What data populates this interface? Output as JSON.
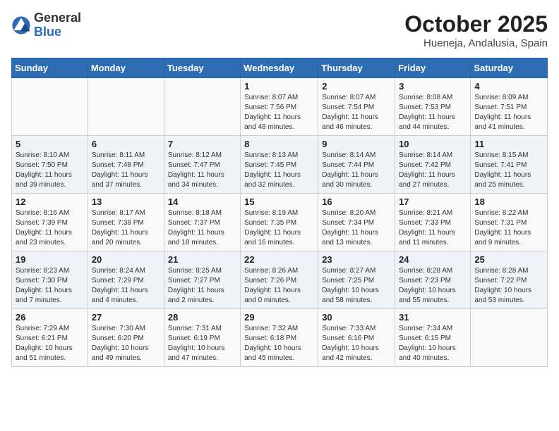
{
  "header": {
    "logo_general": "General",
    "logo_blue": "Blue",
    "month_title": "October 2025",
    "location": "Hueneja, Andalusia, Spain"
  },
  "weekdays": [
    "Sunday",
    "Monday",
    "Tuesday",
    "Wednesday",
    "Thursday",
    "Friday",
    "Saturday"
  ],
  "weeks": [
    [
      {
        "day": "",
        "info": ""
      },
      {
        "day": "",
        "info": ""
      },
      {
        "day": "",
        "info": ""
      },
      {
        "day": "1",
        "info": "Sunrise: 8:07 AM\nSunset: 7:56 PM\nDaylight: 11 hours and 48 minutes."
      },
      {
        "day": "2",
        "info": "Sunrise: 8:07 AM\nSunset: 7:54 PM\nDaylight: 11 hours and 46 minutes."
      },
      {
        "day": "3",
        "info": "Sunrise: 8:08 AM\nSunset: 7:53 PM\nDaylight: 11 hours and 44 minutes."
      },
      {
        "day": "4",
        "info": "Sunrise: 8:09 AM\nSunset: 7:51 PM\nDaylight: 11 hours and 41 minutes."
      }
    ],
    [
      {
        "day": "5",
        "info": "Sunrise: 8:10 AM\nSunset: 7:50 PM\nDaylight: 11 hours and 39 minutes."
      },
      {
        "day": "6",
        "info": "Sunrise: 8:11 AM\nSunset: 7:48 PM\nDaylight: 11 hours and 37 minutes."
      },
      {
        "day": "7",
        "info": "Sunrise: 8:12 AM\nSunset: 7:47 PM\nDaylight: 11 hours and 34 minutes."
      },
      {
        "day": "8",
        "info": "Sunrise: 8:13 AM\nSunset: 7:45 PM\nDaylight: 11 hours and 32 minutes."
      },
      {
        "day": "9",
        "info": "Sunrise: 8:14 AM\nSunset: 7:44 PM\nDaylight: 11 hours and 30 minutes."
      },
      {
        "day": "10",
        "info": "Sunrise: 8:14 AM\nSunset: 7:42 PM\nDaylight: 11 hours and 27 minutes."
      },
      {
        "day": "11",
        "info": "Sunrise: 8:15 AM\nSunset: 7:41 PM\nDaylight: 11 hours and 25 minutes."
      }
    ],
    [
      {
        "day": "12",
        "info": "Sunrise: 8:16 AM\nSunset: 7:39 PM\nDaylight: 11 hours and 23 minutes."
      },
      {
        "day": "13",
        "info": "Sunrise: 8:17 AM\nSunset: 7:38 PM\nDaylight: 11 hours and 20 minutes."
      },
      {
        "day": "14",
        "info": "Sunrise: 8:18 AM\nSunset: 7:37 PM\nDaylight: 11 hours and 18 minutes."
      },
      {
        "day": "15",
        "info": "Sunrise: 8:19 AM\nSunset: 7:35 PM\nDaylight: 11 hours and 16 minutes."
      },
      {
        "day": "16",
        "info": "Sunrise: 8:20 AM\nSunset: 7:34 PM\nDaylight: 11 hours and 13 minutes."
      },
      {
        "day": "17",
        "info": "Sunrise: 8:21 AM\nSunset: 7:33 PM\nDaylight: 11 hours and 11 minutes."
      },
      {
        "day": "18",
        "info": "Sunrise: 8:22 AM\nSunset: 7:31 PM\nDaylight: 11 hours and 9 minutes."
      }
    ],
    [
      {
        "day": "19",
        "info": "Sunrise: 8:23 AM\nSunset: 7:30 PM\nDaylight: 11 hours and 7 minutes."
      },
      {
        "day": "20",
        "info": "Sunrise: 8:24 AM\nSunset: 7:29 PM\nDaylight: 11 hours and 4 minutes."
      },
      {
        "day": "21",
        "info": "Sunrise: 8:25 AM\nSunset: 7:27 PM\nDaylight: 11 hours and 2 minutes."
      },
      {
        "day": "22",
        "info": "Sunrise: 8:26 AM\nSunset: 7:26 PM\nDaylight: 11 hours and 0 minutes."
      },
      {
        "day": "23",
        "info": "Sunrise: 8:27 AM\nSunset: 7:25 PM\nDaylight: 10 hours and 58 minutes."
      },
      {
        "day": "24",
        "info": "Sunrise: 8:28 AM\nSunset: 7:23 PM\nDaylight: 10 hours and 55 minutes."
      },
      {
        "day": "25",
        "info": "Sunrise: 8:28 AM\nSunset: 7:22 PM\nDaylight: 10 hours and 53 minutes."
      }
    ],
    [
      {
        "day": "26",
        "info": "Sunrise: 7:29 AM\nSunset: 6:21 PM\nDaylight: 10 hours and 51 minutes."
      },
      {
        "day": "27",
        "info": "Sunrise: 7:30 AM\nSunset: 6:20 PM\nDaylight: 10 hours and 49 minutes."
      },
      {
        "day": "28",
        "info": "Sunrise: 7:31 AM\nSunset: 6:19 PM\nDaylight: 10 hours and 47 minutes."
      },
      {
        "day": "29",
        "info": "Sunrise: 7:32 AM\nSunset: 6:18 PM\nDaylight: 10 hours and 45 minutes."
      },
      {
        "day": "30",
        "info": "Sunrise: 7:33 AM\nSunset: 6:16 PM\nDaylight: 10 hours and 42 minutes."
      },
      {
        "day": "31",
        "info": "Sunrise: 7:34 AM\nSunset: 6:15 PM\nDaylight: 10 hours and 40 minutes."
      },
      {
        "day": "",
        "info": ""
      }
    ]
  ]
}
